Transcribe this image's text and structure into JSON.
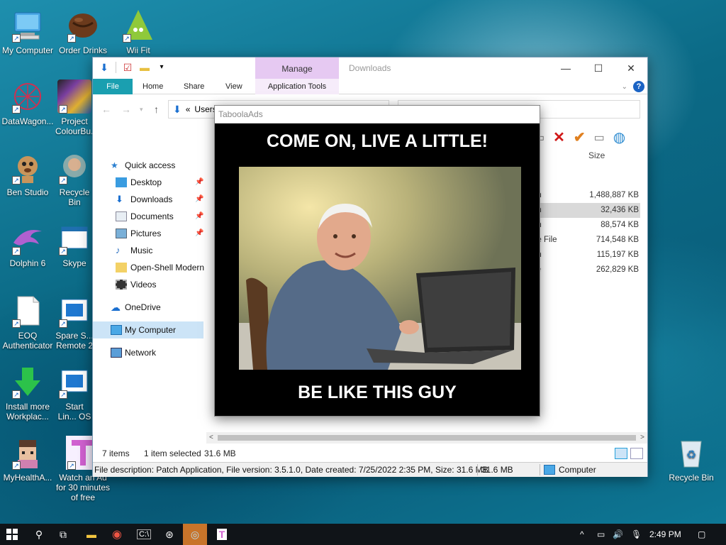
{
  "desktop": {
    "icons": [
      {
        "label": "My Computer"
      },
      {
        "label": "Order Drinks"
      },
      {
        "label": "Wii Fit Reminder"
      },
      {
        "label": "DataWagon..."
      },
      {
        "label": "Project ColourBu..."
      },
      {
        "label": "Ben Studio"
      },
      {
        "label": "Recycle Bin"
      },
      {
        "label": "Dolphin 6"
      },
      {
        "label": "Skype"
      },
      {
        "label": "EOQ Authenticator"
      },
      {
        "label": "Spare S... Remote 2"
      },
      {
        "label": "Install more Workplac..."
      },
      {
        "label": "Start Lin... OS"
      },
      {
        "label": "MyHealthA..."
      },
      {
        "label": "Watch an Ad for 30 minutes of free"
      },
      {
        "label": "Recycle Bin"
      }
    ]
  },
  "explorer": {
    "title": "Downloads",
    "manage_tab": "Manage",
    "tabs": {
      "file": "File",
      "home": "Home",
      "share": "Share",
      "view": "View",
      "app_tools": "Application Tools"
    },
    "address": {
      "prefix": "«",
      "path": "Users"
    },
    "nav": {
      "quick_access": "Quick access",
      "items": [
        "Desktop",
        "Downloads",
        "Documents",
        "Pictures",
        "Music",
        "Open-Shell Modern",
        "Videos"
      ],
      "onedrive": "OneDrive",
      "my_computer": "My Computer",
      "network": "Network"
    },
    "columns": {
      "size": "Size"
    },
    "rows": [
      {
        "type": "on",
        "size": "1,488,887 KB"
      },
      {
        "type": "on",
        "size": "32,436 KB"
      },
      {
        "type": "on",
        "size": "88,574 KB"
      },
      {
        "type": "ge File",
        "size": "714,548 KB"
      },
      {
        "type": "on",
        "size": "115,197 KB"
      },
      {
        "type": "ve",
        "size": "262,829 KB"
      },
      {
        "type": "r",
        "size": ""
      }
    ],
    "status": {
      "items": "7 items",
      "selected": "1 item selected",
      "selected_size": "31.6 MB"
    },
    "description": {
      "text": "File description: Patch Application, File version: 3.5.1.0, Date created: 7/25/2022 2:35 PM, Size: 31.6 MB",
      "size": "31.6 MB",
      "location": "Computer"
    }
  },
  "ad": {
    "window_title": "TaboolaAds",
    "headline": "COME ON, LIVE A LITTLE!",
    "footer": "BE LIKE THIS GUY"
  },
  "taskbar": {
    "time": "2:49 PM"
  },
  "colors": {
    "accent": "#1a9fb0",
    "manage": "#e6c9f2",
    "taskbar_active": "#c8742a"
  }
}
